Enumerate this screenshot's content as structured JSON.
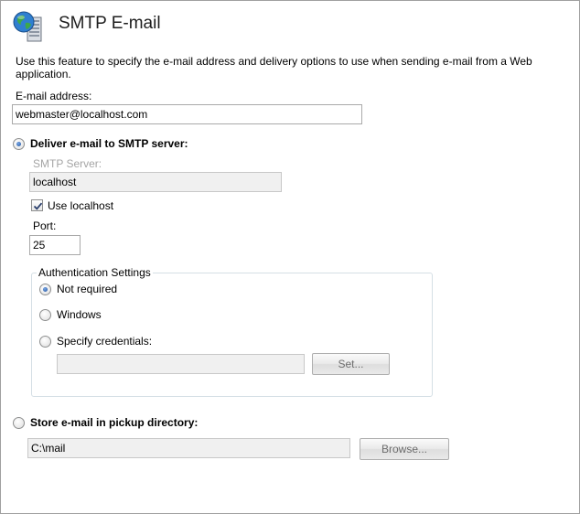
{
  "header": {
    "title": "SMTP E-mail",
    "icon": "globe-server-icon"
  },
  "description": "Use this feature to specify the e-mail address and delivery options to use when sending e-mail from a Web application.",
  "email": {
    "label": "E-mail address:",
    "value": "webmaster@localhost.com"
  },
  "deliver_smtp": {
    "label": "Deliver e-mail to SMTP server:",
    "selected": true,
    "server_label": "SMTP Server:",
    "server_value": "localhost",
    "use_localhost_label": "Use localhost",
    "use_localhost_checked": true,
    "port_label": "Port:",
    "port_value": "25"
  },
  "auth": {
    "legend": "Authentication Settings",
    "options": [
      {
        "label": "Not required",
        "selected": true
      },
      {
        "label": "Windows",
        "selected": false
      },
      {
        "label": "Specify credentials:",
        "selected": false
      }
    ],
    "credentials_value": "",
    "set_button": "Set..."
  },
  "pickup": {
    "label": "Store e-mail in pickup directory:",
    "selected": false,
    "directory_value": "C:\\mail",
    "browse_button": "Browse..."
  },
  "colors": {
    "accent": "#1d4f9c",
    "disabled_bg": "#f0f0f0",
    "border": "#a9a9a9"
  }
}
